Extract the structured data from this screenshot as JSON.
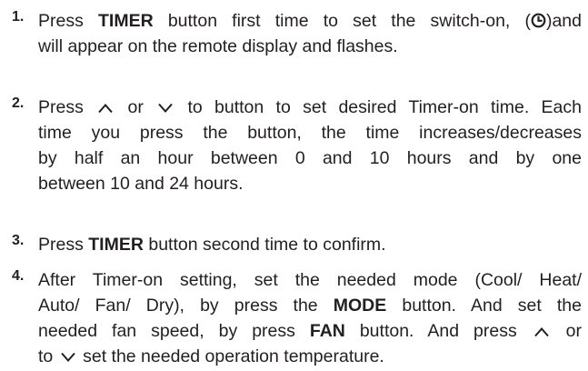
{
  "steps": [
    {
      "number": "1.",
      "lines": [
        [
          "Press ",
          {
            "b": "TIMER"
          },
          " button first time to set the switch-on, (",
          {
            "icon": "clock"
          },
          ")and"
        ],
        [
          "will appear on the remote display and flashes."
        ]
      ]
    },
    {
      "number": "2.",
      "lines": [
        [
          "Press ",
          {
            "icon": "up"
          },
          " or ",
          {
            "icon": "down"
          },
          " to button to set desired Timer-on time. Each"
        ],
        [
          "time you press the button, the time increases/decreases"
        ],
        [
          "by half an hour between 0 and 10 hours and by one"
        ],
        [
          "between 10 and 24  hours."
        ]
      ]
    },
    {
      "number": "3.",
      "lines": [
        [
          "Press ",
          {
            "b": "TIMER"
          },
          " button second time to confirm."
        ]
      ]
    },
    {
      "number": "4.",
      "lines": [
        [
          "After Timer-on setting, set the needed mode (Cool/ Heat/"
        ],
        [
          "Auto/ Fan/ Dry), by press the ",
          {
            "b": "MODE"
          },
          " button. And set the"
        ],
        [
          "needed fan speed, by press ",
          {
            "b": "FAN"
          },
          " button. And press ",
          {
            "icon": "up"
          },
          " or"
        ],
        [
          "to ",
          {
            "icon": "down"
          },
          " set the needed operation temperature."
        ]
      ]
    }
  ]
}
